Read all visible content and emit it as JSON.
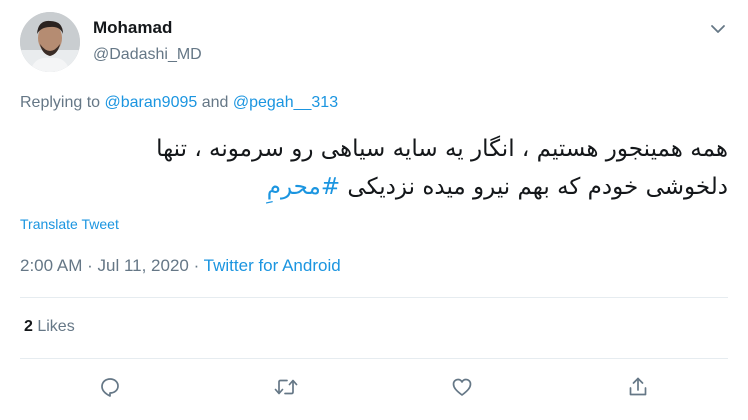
{
  "tweet": {
    "author_name": "Mohamad",
    "author_handle": "@Dadashi_MD",
    "replying_prefix": "Replying to ",
    "reply_to_1": "@baran9095",
    "reply_and": " and ",
    "reply_to_2": "@pegah__313",
    "text_line1": "همه همینجور هستیم ، انگار یه سایه سیاهی رو سرمونه ، تنها",
    "text_line2_prefix": "دلخوشی خودم که بهم نیرو میده نزدیکی ",
    "hashtag": "#محرمِ",
    "translate_label": "Translate Tweet",
    "time": "2:00 AM",
    "sep1": " · ",
    "date": "Jul 11, 2020",
    "sep2": " · ",
    "source": "Twitter for Android",
    "likes_count": "2",
    "likes_label": " Likes"
  },
  "icons": {
    "caret": "chevron-down-icon",
    "reply": "reply-icon",
    "retweet": "retweet-icon",
    "like": "heart-icon",
    "share": "share-icon"
  },
  "colors": {
    "link": "#1b95e0",
    "secondary_text": "#657786",
    "primary_text": "#14171a",
    "divider": "#e6ecf0"
  }
}
